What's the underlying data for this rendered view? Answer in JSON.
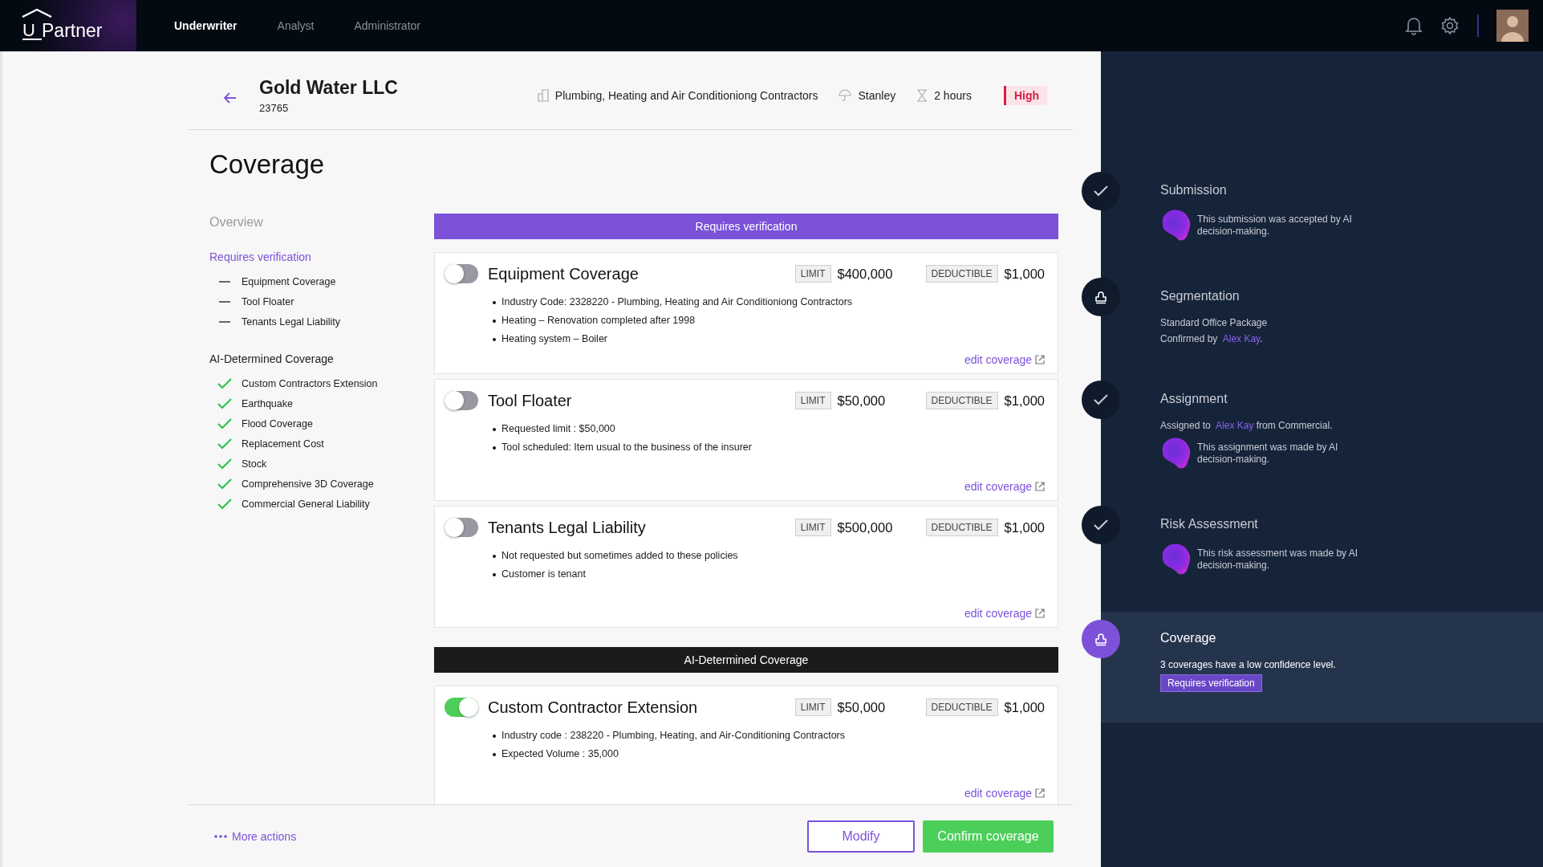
{
  "logo": {
    "mark": "U",
    "text": "Partner"
  },
  "nav": {
    "tabs": [
      {
        "label": "Underwriter",
        "selected": true
      },
      {
        "label": "Analyst",
        "selected": false
      },
      {
        "label": "Administrator",
        "selected": false
      }
    ]
  },
  "header": {
    "title": "Gold Water LLC",
    "id": "23765",
    "meta": [
      {
        "kind": "industry",
        "text": "Plumbing, Heating and Air Conditioniong Contractors"
      },
      {
        "kind": "person",
        "text": "Stanley"
      },
      {
        "kind": "time",
        "text": "2 hours"
      }
    ],
    "priority": "High"
  },
  "page_title": "Coverage",
  "sidebar": {
    "overview": "Overview",
    "sections": [
      {
        "title": "Requires verification",
        "kind": "pending",
        "selected": true,
        "items": [
          "Equipment Coverage",
          "Tool Floater",
          "Tenants Legal Liability"
        ]
      },
      {
        "title": "AI-Determined Coverage",
        "kind": "done",
        "selected": false,
        "items": [
          "Custom Contractors Extension",
          "Earthquake",
          "Flood Coverage",
          "Replacement Cost",
          "Stock",
          "Comprehensive 3D Coverage",
          "Commercial General Liability"
        ]
      }
    ]
  },
  "groups": [
    {
      "banner": "Requires verification",
      "kind": "verify",
      "cards": [
        {
          "title": "Equipment Coverage",
          "on": false,
          "limit_label": "LIMIT",
          "limit": "$400,000",
          "deductible_label": "DEDUCTIBLE",
          "deductible": "$1,000",
          "bullets": [
            "Industry Code: 2328220 - Plumbing, Heating and Air Conditioniong Contractors",
            "Heating – Renovation completed after 1998",
            "Heating system – Boiler"
          ],
          "edit": "edit coverage"
        },
        {
          "title": "Tool Floater",
          "on": false,
          "limit_label": "LIMIT",
          "limit": "$50,000",
          "deductible_label": "DEDUCTIBLE",
          "deductible": "$1,000",
          "bullets": [
            "Requested limit : $50,000",
            "Tool scheduled: Item usual to the business of the insurer"
          ],
          "edit": "edit coverage"
        },
        {
          "title": "Tenants Legal Liability",
          "on": false,
          "limit_label": "LIMIT",
          "limit": "$500,000",
          "deductible_label": "DEDUCTIBLE",
          "deductible": "$1,000",
          "bullets": [
            "Not requested but sometimes added to these policies",
            "Customer is tenant"
          ],
          "edit": "edit coverage"
        }
      ]
    },
    {
      "banner": "AI-Determined Coverage",
      "kind": "ai",
      "cards": [
        {
          "title": "Custom Contractor Extension",
          "on": true,
          "limit_label": "LIMIT",
          "limit": "$50,000",
          "deductible_label": "DEDUCTIBLE",
          "deductible": "$1,000",
          "bullets": [
            "Industry code : 238220 - Plumbing, Heating, and Air-Conditioning Contractors",
            "Expected Volume : 35,000"
          ],
          "edit": "edit coverage"
        }
      ]
    }
  ],
  "footer": {
    "more_actions": "More actions",
    "buttons": [
      {
        "kind": "secondary",
        "label": "Modify"
      },
      {
        "kind": "primary",
        "label": "Confirm coverage"
      }
    ]
  },
  "timeline": [
    {
      "title": "Submission",
      "kind": "done",
      "selected": false,
      "ai_note": "This submission was accepted by AI decision-making."
    },
    {
      "title": "Segmentation",
      "kind": "manual",
      "selected": false,
      "lines": [
        [
          {
            "kind": "text",
            "text": "Standard Office Package"
          }
        ],
        [
          {
            "kind": "text",
            "text": "Confirmed by"
          },
          {
            "kind": "link",
            "text": "Alex Kay"
          },
          {
            "kind": "text",
            "text": "."
          }
        ]
      ]
    },
    {
      "title": "Assignment",
      "kind": "done",
      "selected": false,
      "lines": [
        [
          {
            "kind": "text",
            "text": "Assigned to"
          },
          {
            "kind": "link",
            "text": "Alex Kay"
          },
          {
            "kind": "text",
            "text": "from Commercial."
          }
        ]
      ],
      "ai_note": "This assignment was made by AI decision-making."
    },
    {
      "title": "Risk Assessment",
      "kind": "done",
      "selected": false,
      "ai_note": "This risk assessment was made by AI decision-making."
    },
    {
      "title": "Coverage",
      "kind": "manual",
      "selected": true,
      "lines": [
        [
          {
            "kind": "text",
            "text": "3 coverages have a low confidence level."
          }
        ]
      ],
      "badge": "Requires verification"
    }
  ]
}
